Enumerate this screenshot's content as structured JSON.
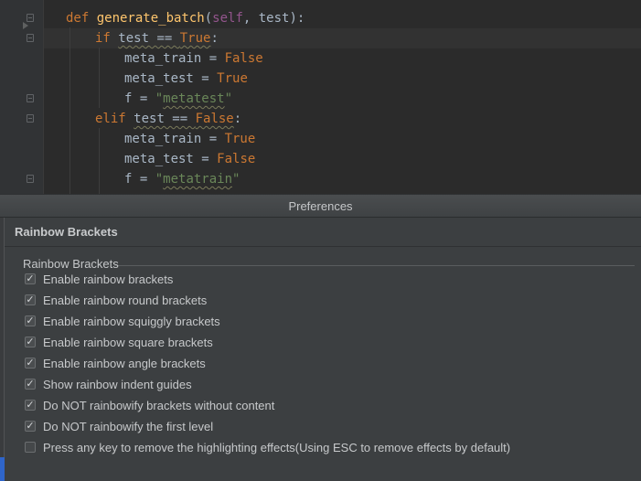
{
  "editor": {
    "lines": [
      {
        "parts": [
          [
            "kw",
            "def "
          ],
          [
            "fn",
            "generate_batch"
          ],
          [
            "",
            "("
          ],
          [
            "self",
            "self"
          ],
          [
            "",
            ", test):"
          ]
        ]
      },
      {
        "parts": [
          [
            "kw",
            "if "
          ],
          [
            "wavy",
            "test == "
          ],
          [
            "kw wavy",
            "True"
          ],
          [
            "",
            ":"
          ]
        ]
      },
      {
        "parts": [
          [
            "",
            "meta_train = "
          ],
          [
            "kw",
            "False"
          ]
        ]
      },
      {
        "parts": [
          [
            "",
            "meta_test = "
          ],
          [
            "kw",
            "True"
          ]
        ]
      },
      {
        "parts": [
          [
            "",
            "f = "
          ],
          [
            "str",
            "\""
          ],
          [
            "str wavy",
            "metatest"
          ],
          [
            "str",
            "\""
          ]
        ]
      },
      {
        "parts": [
          [
            "kw",
            "elif "
          ],
          [
            "wavy",
            "test == "
          ],
          [
            "kw wavy",
            "False"
          ],
          [
            "",
            ":"
          ]
        ]
      },
      {
        "parts": [
          [
            "",
            "meta_train = "
          ],
          [
            "kw",
            "True"
          ]
        ]
      },
      {
        "parts": [
          [
            "",
            "meta_test = "
          ],
          [
            "kw",
            "False"
          ]
        ]
      },
      {
        "parts": [
          [
            "",
            "f = "
          ],
          [
            "str",
            "\""
          ],
          [
            "str wavy",
            "metatrain"
          ],
          [
            "str",
            "\""
          ]
        ]
      }
    ]
  },
  "window": {
    "title": "Preferences"
  },
  "settings": {
    "heading": "Rainbow Brackets",
    "group_title": "Rainbow Brackets",
    "options": [
      {
        "label": "Enable rainbow brackets",
        "checked": true
      },
      {
        "label": "Enable rainbow round brackets",
        "checked": true
      },
      {
        "label": "Enable rainbow squiggly brackets",
        "checked": true
      },
      {
        "label": "Enable rainbow square brackets",
        "checked": true
      },
      {
        "label": "Enable rainbow angle brackets",
        "checked": true
      },
      {
        "label": "Show rainbow indent guides",
        "checked": true
      },
      {
        "label": "Do NOT rainbowify brackets without content",
        "checked": true
      },
      {
        "label": "Do NOT rainbowify the first level",
        "checked": true
      },
      {
        "label": "Press any key to remove the highlighting effects(Using ESC to remove effects by default)",
        "checked": false
      }
    ]
  },
  "colors": {
    "keyword": "#cc7832",
    "function": "#ffc66d",
    "string": "#6a8759",
    "self": "#94558d",
    "accent": "#2f65ca"
  }
}
